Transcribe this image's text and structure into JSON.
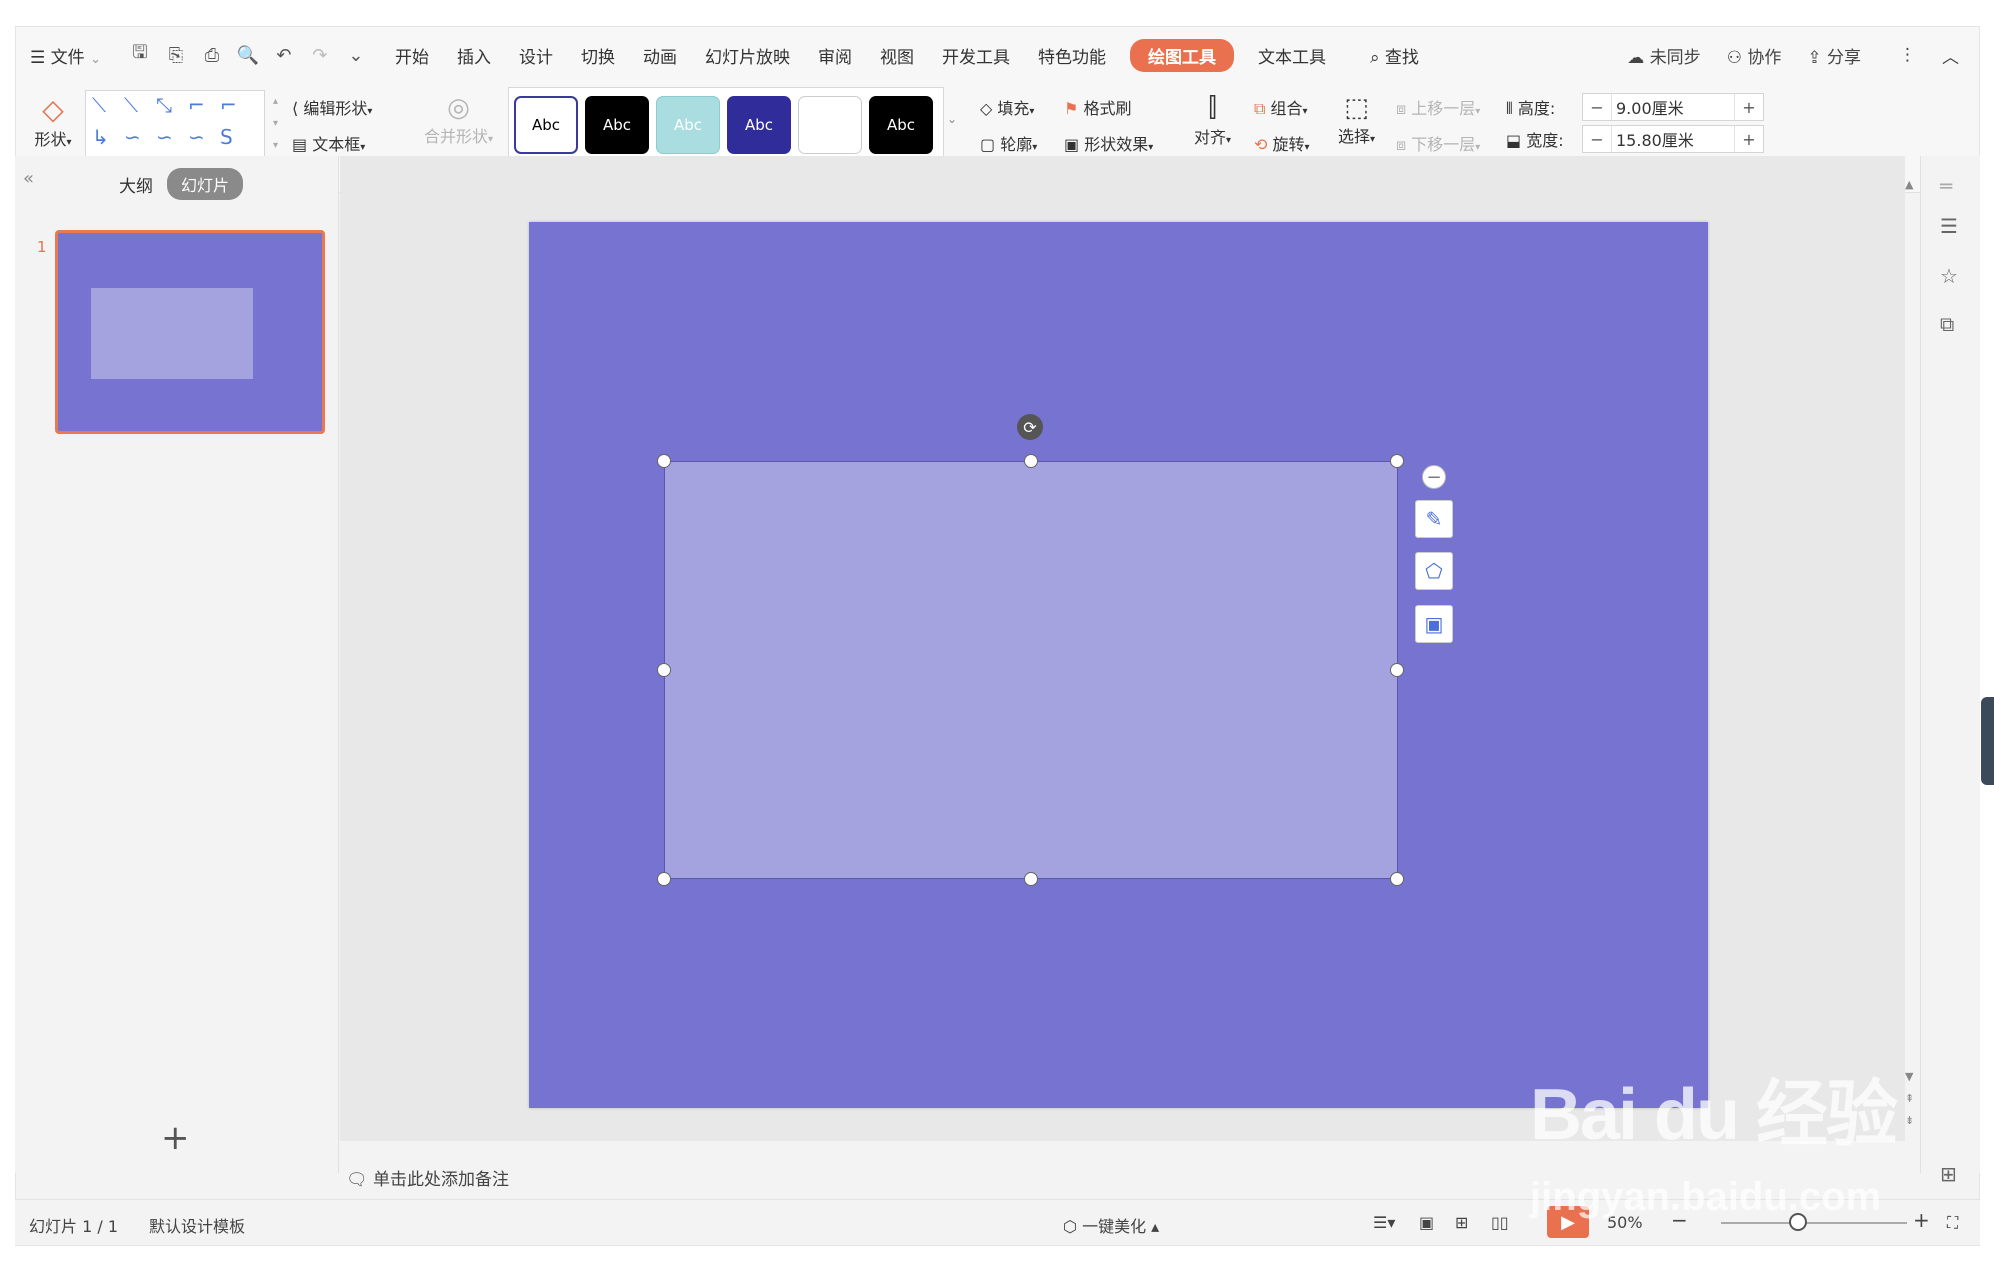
{
  "menubar": {
    "file_label": "文件",
    "tabs": [
      "开始",
      "插入",
      "设计",
      "切换",
      "动画",
      "幻灯片放映",
      "审阅",
      "视图",
      "开发工具",
      "特色功能"
    ],
    "drawing_tools_tab": "绘图工具",
    "text_tools_tab": "文本工具",
    "search_label": "查找",
    "sync_label": "未同步",
    "collab_label": "协作",
    "share_label": "分享"
  },
  "ribbon": {
    "shape_label": "形状",
    "edit_shape_label": "编辑形状",
    "textbox_label": "文本框",
    "merge_shape_label": "合并形状",
    "style_swatches": [
      {
        "text": "Abc",
        "bg": "#ffffff",
        "fg": "#000000",
        "border": "#3a3a9a"
      },
      {
        "text": "Abc",
        "bg": "#000000",
        "fg": "#ffffff",
        "border": "#000000"
      },
      {
        "text": "Abc",
        "bg": "#a9dde0",
        "fg": "#ffffff",
        "border": "#8ccbd0"
      },
      {
        "text": "Abc",
        "bg": "#302c9a",
        "fg": "#ffffff",
        "border": "#302c9a"
      },
      {
        "text": "",
        "bg": "#ffffff",
        "fg": "#000000",
        "border": "#cccccc"
      },
      {
        "text": "Abc",
        "bg": "#000000",
        "fg": "#ffffff",
        "border": "#000000"
      }
    ],
    "fill_label": "填充",
    "format_painter_label": "格式刷",
    "outline_label": "轮廓",
    "shape_effect_label": "形状效果",
    "align_label": "对齐",
    "group_label": "组合",
    "rotate_label": "旋转",
    "select_label": "选择",
    "bring_forward_label": "上移一层",
    "send_backward_label": "下移一层",
    "height_label": "高度:",
    "height_value": "9.00厘米",
    "width_label": "宽度:",
    "width_value": "15.80厘米"
  },
  "leftpanel": {
    "outline_tab": "大纲",
    "slides_tab": "幻灯片",
    "slide_number": "1"
  },
  "notes_placeholder": "单击此处添加备注",
  "status": {
    "slide_info": "幻灯片 1 / 1",
    "template": "默认设计模板",
    "beautify": "一键美化",
    "zoom": "50%"
  },
  "colors": {
    "slide_bg": "#7674d0",
    "shape_fill": "#a4a2df",
    "accent": "#e9714f"
  },
  "watermark": {
    "brand": "Bai du 经验",
    "url": "jingyan.baidu.com"
  }
}
